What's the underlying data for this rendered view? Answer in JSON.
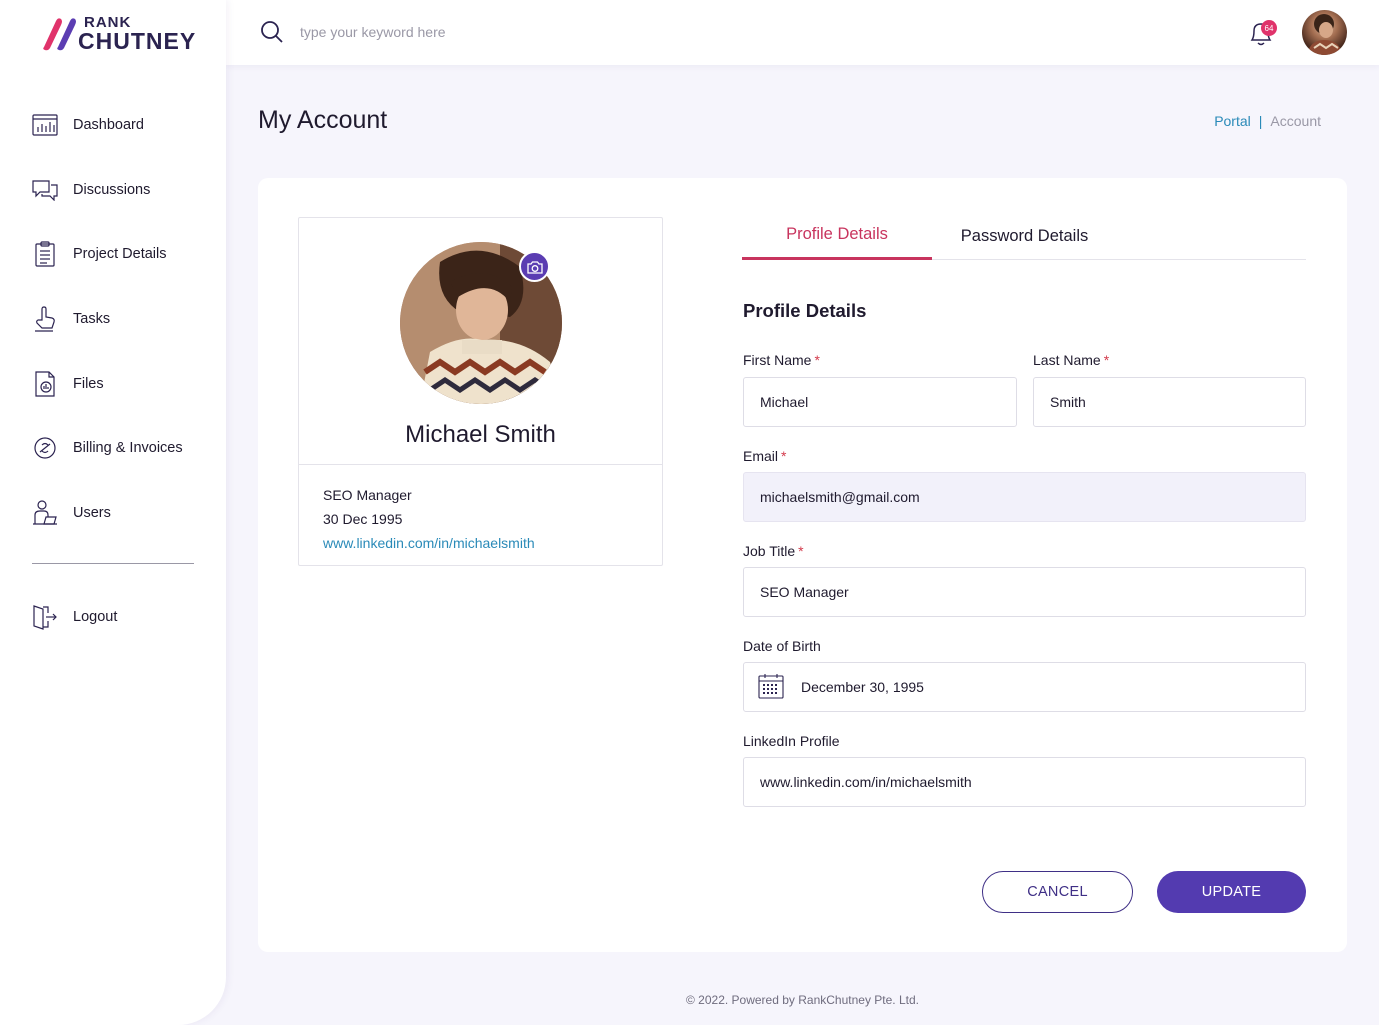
{
  "brand": {
    "name_top": "RANK",
    "name_bottom": "CHUTNEY",
    "logo_colors": [
      "#e0336b",
      "#5b3db2"
    ]
  },
  "sidebar": {
    "items": [
      {
        "label": "Dashboard",
        "icon": "dashboard-chart-icon"
      },
      {
        "label": "Discussions",
        "icon": "chat-bubbles-icon"
      },
      {
        "label": "Project Details",
        "icon": "clipboard-icon"
      },
      {
        "label": "Tasks",
        "icon": "hand-pointer-icon"
      },
      {
        "label": "Files",
        "icon": "file-chart-icon"
      },
      {
        "label": "Billing & Invoices",
        "icon": "billing-icon"
      },
      {
        "label": "Users",
        "icon": "user-desk-icon"
      }
    ],
    "logout": {
      "label": "Logout",
      "icon": "logout-icon"
    }
  },
  "topbar": {
    "search_placeholder": "type your keyword here",
    "notification_count": "64"
  },
  "page": {
    "title": "My Account",
    "breadcrumb": {
      "parent": "Portal",
      "separator": "|",
      "current": "Account"
    }
  },
  "profile_card": {
    "name": "Michael Smith",
    "job_title": "SEO Manager",
    "dob": "30 Dec 1995",
    "linkedin": "www.linkedin.com/in/michaelsmith"
  },
  "tabs": [
    {
      "label": "Profile Details",
      "active": true
    },
    {
      "label": "Password Details",
      "active": false
    }
  ],
  "form": {
    "section_title": "Profile Details",
    "first_name": {
      "label": "First Name",
      "required": "*",
      "value": "Michael"
    },
    "last_name": {
      "label": "Last Name",
      "required": "*",
      "value": "Smith"
    },
    "email": {
      "label": "Email",
      "required": "*",
      "value": "michaelsmith@gmail.com"
    },
    "job_title": {
      "label": "Job Title",
      "required": "*",
      "value": "SEO Manager"
    },
    "dob": {
      "label": "Date of Birth",
      "value": "December 30, 1995"
    },
    "linkedin": {
      "label": "LinkedIn Profile",
      "value": "www.linkedin.com/in/michaelsmith"
    },
    "cancel_label": "CANCEL",
    "update_label": "UPDATE"
  },
  "colors": {
    "accent_purple": "#533bb0",
    "accent_pink": "#c8345e",
    "link_blue": "#2a8ab8"
  },
  "footer": "© 2022. Powered by RankChutney Pte. Ltd."
}
